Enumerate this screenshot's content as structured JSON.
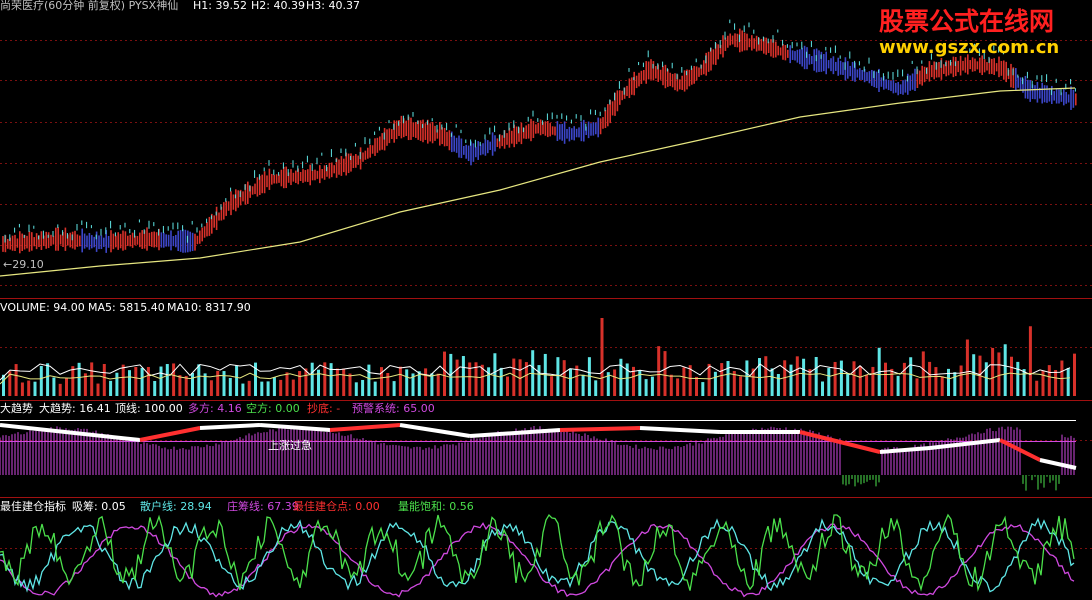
{
  "colors": {
    "up": "#d8312a",
    "down": "#3c46c8",
    "cyan": "#5fe6e6",
    "magenta": "#d049e0",
    "white": "#ffffff",
    "yellow": "#e6e680",
    "green": "#4be04b",
    "red": "#ff3030",
    "sep": "#a01010",
    "grid": "#7a1010",
    "gray": "#c0c0c0"
  },
  "panels": {
    "main": {
      "stock_title": "尚荣医疗(60分钟 前复权) PYSX神仙",
      "h1_label": "H1: 39.52",
      "h2_label": "H2: 40.39",
      "h3_label": "H3: 40.37",
      "low_marker": "←29.10"
    },
    "volume": {
      "title": "VOLUME: 94.00",
      "ma5": "MA5: 5815.40",
      "ma10": "MA10: 8317.90"
    },
    "trend": {
      "name": "大趋势",
      "trend_value": "大趋势: 16.41",
      "top_line": "顶线: 100.00",
      "long_side": "多方: 4.16",
      "short_side": "空方: 0.00",
      "bottom_fish": "抄底: -",
      "warning": "预警系统: 65.00",
      "annotation": "上涨过急"
    },
    "position": {
      "name": "最佳建仓指标",
      "absorb": "吸筹: 0.05",
      "retail": "散户线: 28.94",
      "banker": "庄筹线: 67.39",
      "best_point": "最佳建仓点: 0.00",
      "saturation": "量能饱和: 0.56"
    }
  },
  "watermark": {
    "title": "股票公式在线网",
    "url": "www.gszx.com.cn"
  }
}
